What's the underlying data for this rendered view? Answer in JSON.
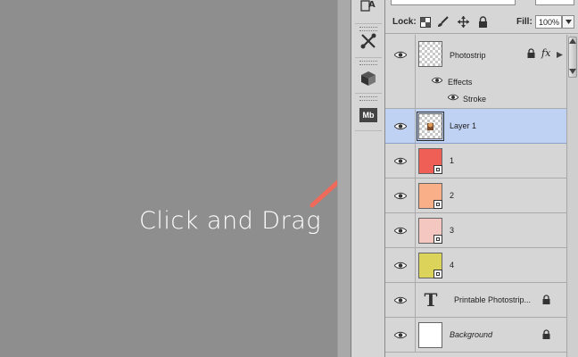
{
  "canvas": {
    "instruction": "Click and Drag",
    "arrow_color": "#f06a5a"
  },
  "toolbar_icons": [
    "character-style-icon",
    "tools-preset-icon",
    "3d-cube-icon",
    "mini-bridge-icon"
  ],
  "toolbar": {
    "mini_bridge_label": "Mb"
  },
  "panel": {
    "lock_label": "Lock:",
    "fill_label": "Fill:",
    "fill_value": "100%",
    "layers": [
      {
        "name": "Photostrip",
        "type": "transparent",
        "locked": true,
        "fx": true
      },
      {
        "name": "Layer 1",
        "type": "image",
        "selected": true
      },
      {
        "name": "1",
        "type": "smart",
        "color": "#ef5f56"
      },
      {
        "name": "2",
        "type": "smart",
        "color": "#f9b089"
      },
      {
        "name": "3",
        "type": "smart",
        "color": "#f4c7c0"
      },
      {
        "name": "4",
        "type": "smart",
        "color": "#dcd45a"
      },
      {
        "name": "Printable Photostrip...",
        "type": "text",
        "locked": true
      },
      {
        "name": "Background",
        "type": "background",
        "locked": true,
        "italic": true
      }
    ],
    "effects_label": "Effects",
    "stroke_label": "Stroke",
    "fx_badge": "fx"
  }
}
